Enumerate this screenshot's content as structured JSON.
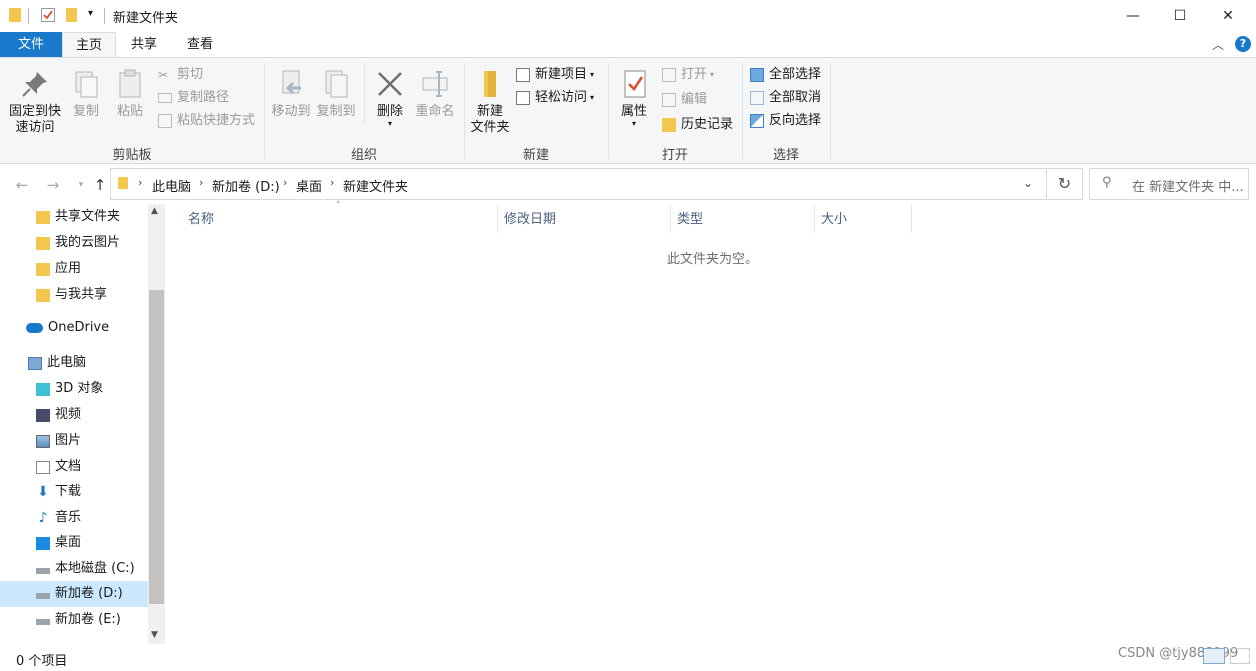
{
  "window": {
    "title": "新建文件夹",
    "minimize_glyph": "—",
    "maximize_glyph": "☐",
    "close_glyph": "✕"
  },
  "tabs": {
    "file": "文件",
    "home": "主页",
    "share": "共享",
    "view": "查看"
  },
  "ribbon": {
    "clipboard": {
      "label": "剪贴板",
      "pin": "固定到快\n速访问",
      "copy": "复制",
      "paste": "粘贴",
      "cut": "剪切",
      "copy_path": "复制路径",
      "paste_shortcut": "粘贴快捷方式"
    },
    "organize": {
      "label": "组织",
      "move_to": "移动到",
      "copy_to": "复制到",
      "delete": "删除",
      "rename": "重命名"
    },
    "new": {
      "label": "新建",
      "new_folder": "新建\n文件夹",
      "new_item": "新建项目",
      "easy_access": "轻松访问"
    },
    "open": {
      "label": "打开",
      "properties": "属性",
      "open": "打开",
      "edit": "编辑",
      "history": "历史记录"
    },
    "select": {
      "label": "选择",
      "select_all": "全部选择",
      "select_none": "全部取消",
      "invert": "反向选择"
    },
    "accent": "#1979ca"
  },
  "address": {
    "crumbs": [
      "此电脑",
      "新加卷 (D:)",
      "桌面",
      "新建文件夹"
    ],
    "search_placeholder": "在 新建文件夹 中..."
  },
  "nav_pane": {
    "items": [
      {
        "label": "共享文件夹",
        "icon": "shared-folder-icon"
      },
      {
        "label": "我的云图片",
        "icon": "folder-icon"
      },
      {
        "label": "应用",
        "icon": "apps-folder-icon"
      },
      {
        "label": "与我共享",
        "icon": "folder-icon"
      },
      {
        "label": "OneDrive",
        "icon": "onedrive-icon"
      },
      {
        "label": "此电脑",
        "icon": "computer-icon"
      },
      {
        "label": "3D 对象",
        "icon": "3d-objects-icon"
      },
      {
        "label": "视频",
        "icon": "video-icon"
      },
      {
        "label": "图片",
        "icon": "pictures-icon"
      },
      {
        "label": "文档",
        "icon": "documents-icon"
      },
      {
        "label": "下载",
        "icon": "download-icon"
      },
      {
        "label": "音乐",
        "icon": "music-icon"
      },
      {
        "label": "桌面",
        "icon": "desktop-icon"
      },
      {
        "label": "本地磁盘 (C:)",
        "icon": "drive-icon"
      },
      {
        "label": "新加卷 (D:)",
        "icon": "drive-icon"
      },
      {
        "label": "新加卷 (E:)",
        "icon": "drive-icon"
      }
    ]
  },
  "columns": {
    "name": "名称",
    "modified": "修改日期",
    "type": "类型",
    "size": "大小"
  },
  "content": {
    "empty_message": "此文件夹为空。"
  },
  "status": {
    "item_count": "0 个项目"
  },
  "watermark": "CSDN @tjy888999"
}
